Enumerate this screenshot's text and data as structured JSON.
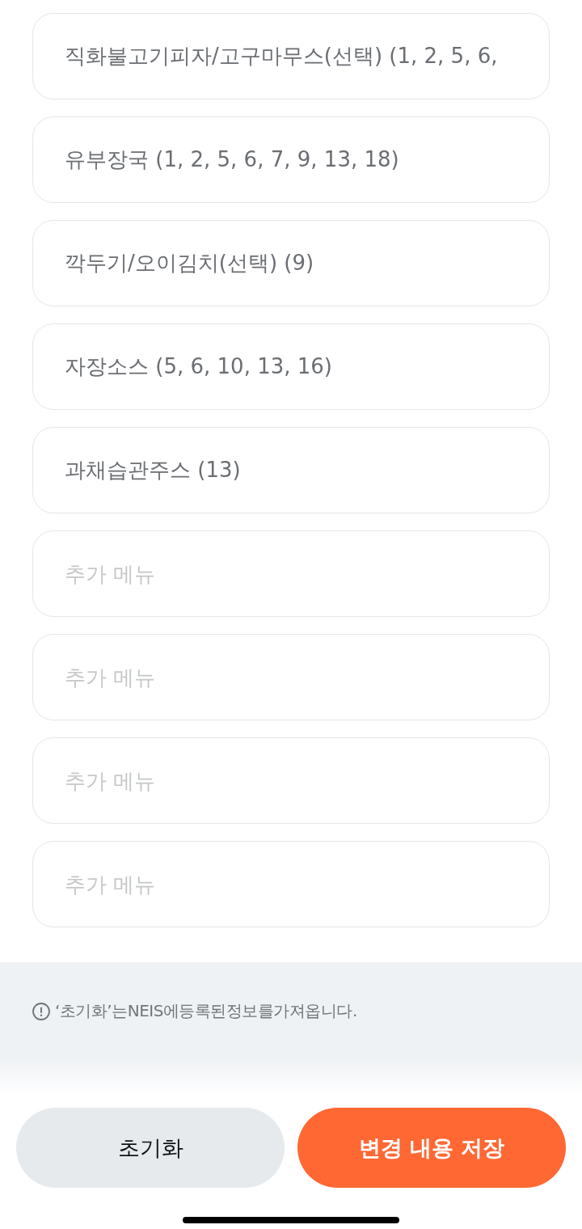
{
  "menu_fields": [
    {
      "value": "직화불고기피자/고구마무스(선택) (1, 2, 5, 6,"
    },
    {
      "value": "유부장국 (1, 2, 5, 6, 7, 9, 13, 18)"
    },
    {
      "value": "깍두기/오이김치(선택) (9)"
    },
    {
      "value": "자장소스 (5, 6, 10, 13, 16)"
    },
    {
      "value": "과채습관주스 (13)"
    },
    {
      "placeholder": "추가 메뉴"
    },
    {
      "placeholder": "추가 메뉴"
    },
    {
      "placeholder": "추가 메뉴"
    },
    {
      "placeholder": "추가 메뉴"
    }
  ],
  "notice": {
    "text": "‘초기화’는NEIS에등록된정보를가져옵니다."
  },
  "buttons": [
    {
      "label": "초기화",
      "kind": "secondary"
    },
    {
      "label": "변경 내용 저장",
      "kind": "primary"
    }
  ]
}
